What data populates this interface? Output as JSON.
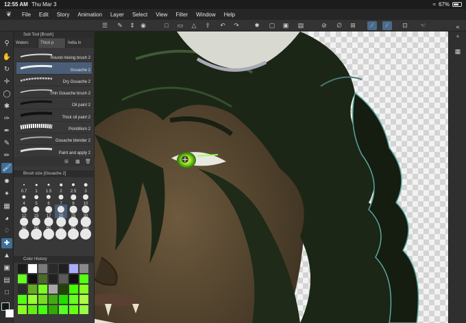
{
  "status": {
    "time": "12:55 AM",
    "date": "Thu Mar 3",
    "battery": "67%",
    "battery_level": 0.67
  },
  "menu": [
    "File",
    "Edit",
    "Story",
    "Animation",
    "Layer",
    "Select",
    "View",
    "Filter",
    "Window",
    "Help"
  ],
  "subtool": {
    "title": "Sub Tool [Brush]",
    "tabs": [
      "Waterc",
      "Thick p",
      "India in"
    ],
    "active_tab": 1,
    "brushes": [
      "Round mixing brush 2",
      "Gouache 2",
      "Dry Gouache 2",
      "Thin Gouache brush 2",
      "Oil paint 2",
      "Thick oil paint 2",
      "Pointillism 2",
      "Gouache blender 2",
      "Paint and apply 2"
    ],
    "active_brush": 1
  },
  "brush_size": {
    "title": "Brush size [Gouache 2]",
    "values": [
      "0.7",
      "1",
      "1.5",
      "2",
      "2.5",
      "3",
      "4",
      "5",
      "6",
      "7",
      "8",
      "10",
      "12",
      "15",
      "17",
      "20",
      "25",
      "30",
      "40",
      "50",
      "60",
      "70",
      "80",
      "100",
      "",
      "",
      "",
      "",
      "",
      ""
    ],
    "active_value": "20"
  },
  "color_history": {
    "title": "Color History",
    "colors": [
      "#1a1a1a",
      "#ffffff",
      "#7a7a7a",
      "#2a2a2a",
      "#1f1f1f",
      "#aaaaff",
      "#8a8a8a",
      "#66ff22",
      "#111111",
      "#4a6a2a",
      "#222222",
      "#5a5a5a",
      "#111111",
      "#55ff11",
      "#2a2a2a",
      "#66aa22",
      "#77ff22",
      "#a8a8a8",
      "#224400",
      "#44ff00",
      "#88ff22",
      "#55ff11",
      "#99ff33",
      "#77dd22",
      "#44aa11",
      "#22dd00",
      "#66ff22",
      "#aaff44",
      "#88ff22",
      "#66ee11",
      "#44ff11",
      "#33aa00",
      "#55ff22",
      "#66ff11",
      "#99ff44"
    ]
  },
  "colors": {
    "accent": "#3d6f99",
    "panel": "#383838",
    "selected": "#4a5e78"
  }
}
